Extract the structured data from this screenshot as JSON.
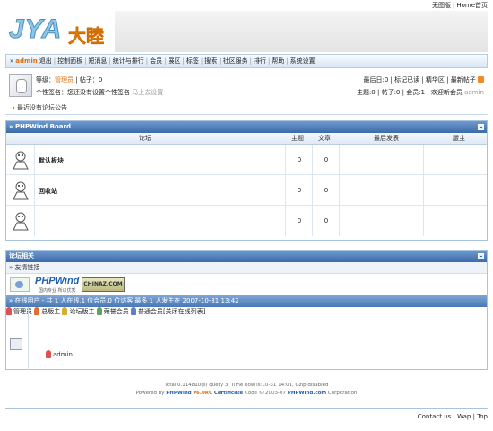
{
  "toplinks": {
    "simple": "无图版",
    "home": "Home首页"
  },
  "logo": {
    "latin": "JYA",
    "cn": "大睦"
  },
  "nav": {
    "user": "admin",
    "items": [
      "退出",
      "控制面板",
      "短消息",
      "统计与排行",
      "会员",
      "展区",
      "标签",
      "搜索",
      "社区服务",
      "排行",
      "帮助",
      "系统设置"
    ]
  },
  "user": {
    "level_label": "等级：",
    "level": "管理员",
    "posts": "| 帖子：0",
    "sign_label": "个性签名：",
    "sign": "您还没有设置个性签名",
    "sign_link": "马上去设置",
    "no_notice": "最近没有论坛公告",
    "right1": {
      "last_login": "最后日:0",
      "mark_read": "标记已读",
      "digest": "精华区",
      "latest": "最新帖子"
    },
    "right2": {
      "text": "主题:0 | 帖子:0 | 会员:1 | 欢迎新会员",
      "newuser": "admin"
    }
  },
  "board": {
    "title": "» PHPWind Board",
    "columns": [
      "论坛",
      "主题",
      "文章",
      "最后发表",
      "版主"
    ],
    "forums": [
      {
        "name": "默认板块",
        "topics": "0",
        "posts": "0"
      },
      {
        "name": "回收站",
        "topics": "0",
        "posts": "0"
      },
      {
        "name": "",
        "topics": "0",
        "posts": "0"
      }
    ]
  },
  "links": {
    "title": "论坛相关",
    "friend": "» 友情链接",
    "phpwind": "PHPWind",
    "phpwind_sub": "国内专业 所以优秀",
    "chinaz": "CHINAZ.COM",
    "online_title": "» 在线用户 - 共 1 人在线,1 位会员,0 位访客,最多 1 人发生在 2007-10-31 13:42",
    "legend": [
      {
        "label": "管理员",
        "color": "#e05050"
      },
      {
        "label": "总版主",
        "color": "#e07030"
      },
      {
        "label": "论坛版主",
        "color": "#d0b030"
      },
      {
        "label": "荣誉会员",
        "color": "#60a060"
      },
      {
        "label": "普通会员",
        "color": "#6080c0"
      }
    ],
    "close_online": "[关闭在线列表]",
    "online_user": "admin"
  },
  "footer": {
    "line1": "Total 0.114810(s) query 3, Time now is:10-31 14:01, Gzip disabled",
    "powered": "Powered by",
    "pw": "PHPWind",
    "ver": "v6.0RC",
    "cert": "Certificate",
    "code": "Code © 2003-07",
    "com": "PHPWind.com",
    "corp": "Corporation",
    "bottom": {
      "contact": "Contact us",
      "wap": "Wap",
      "top": "Top"
    }
  }
}
